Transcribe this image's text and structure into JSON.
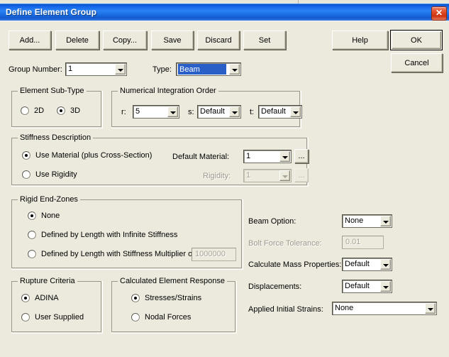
{
  "window": {
    "title": "Define Element Group",
    "close_label": "✕",
    "close_icon": "close-icon"
  },
  "toolbar": {
    "buttons": [
      {
        "label": "Add..."
      },
      {
        "label": "Delete"
      },
      {
        "label": "Copy..."
      },
      {
        "label": "Save"
      },
      {
        "label": "Discard"
      },
      {
        "label": "Set"
      }
    ],
    "help_label": "Help",
    "ok_label": "OK",
    "cancel_label": "Cancel"
  },
  "header": {
    "group_number_label": "Group Number:",
    "group_number_value": "1",
    "type_label": "Type:",
    "type_value": "Beam"
  },
  "element_sub_type": {
    "title": "Element Sub-Type",
    "options": [
      {
        "label": "2D",
        "selected": false
      },
      {
        "label": "3D",
        "selected": true
      }
    ]
  },
  "integration_order": {
    "title": "Numerical Integration Order",
    "r_label": "r:",
    "r_value": "5",
    "s_label": "s:",
    "s_value": "Default",
    "t_label": "t:",
    "t_value": "Default"
  },
  "stiffness": {
    "title": "Stiffness Description",
    "options": [
      {
        "label": "Use Material (plus Cross-Section)",
        "selected": true
      },
      {
        "label": "Use Rigidity",
        "selected": false
      }
    ],
    "default_material_label": "Default Material:",
    "default_material_value": "1",
    "default_material_browse": "...",
    "rigidity_label": "Rigidity:",
    "rigidity_value": "1",
    "rigidity_browse": "..."
  },
  "rigid_end_zones": {
    "title": "Rigid End-Zones",
    "options": [
      {
        "label": "None",
        "selected": true
      },
      {
        "label": "Defined by Length with Infinite Stiffness",
        "selected": false
      },
      {
        "label": "Defined by Length with Stiffness Multiplier of",
        "selected": false
      }
    ],
    "multiplier_value": "1000000"
  },
  "rupture": {
    "title": "Rupture Criteria",
    "options": [
      {
        "label": "ADINA",
        "selected": true
      },
      {
        "label": "User Supplied",
        "selected": false
      }
    ]
  },
  "element_response": {
    "title": "Calculated Element Response",
    "options": [
      {
        "label": "Stresses/Strains",
        "selected": true
      },
      {
        "label": "Nodal Forces",
        "selected": false
      }
    ]
  },
  "right_panel": {
    "rows": [
      {
        "label": "Beam Option:",
        "value": "None"
      },
      {
        "label": "Bolt Force Tolerance:",
        "value": "0.01"
      },
      {
        "label": "Calculate Mass Properties:",
        "value": "Default"
      },
      {
        "label": "Displacements:",
        "value": "Default"
      },
      {
        "label": "Applied Initial Strains:",
        "value": "None"
      }
    ]
  },
  "colors": {
    "title_bar_blue": "#1767e8",
    "dialog_face": "#ece9dd",
    "selection_blue": "#2a5fc8",
    "close_red": "#cc3311"
  }
}
